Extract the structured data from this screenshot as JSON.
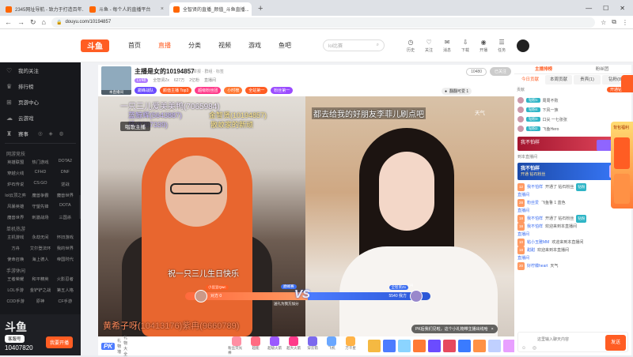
{
  "browser": {
    "tabs": [
      {
        "title": "2345网址导航 - 致力于打造百年..."
      },
      {
        "title": "斗鱼 - 每个人的直播平台"
      },
      {
        "title": "全智贤的直播_颜值_斗鱼直播..."
      }
    ],
    "url": "douyu.com/10194857"
  },
  "site": {
    "logo": "斗鱼",
    "nav": [
      "首页",
      "直播",
      "分类",
      "视频",
      "游戏",
      "鱼吧"
    ],
    "search_placeholder": "lol比赛",
    "header_icons": [
      {
        "label": "历史",
        "icon": "history-icon"
      },
      {
        "label": "关注",
        "icon": "heart-icon"
      },
      {
        "label": "消息",
        "icon": "message-icon"
      },
      {
        "label": "下载",
        "icon": "download-icon"
      },
      {
        "label": "开播",
        "icon": "camera-icon"
      },
      {
        "label": "任务",
        "icon": "task-icon"
      }
    ]
  },
  "sidebar": {
    "top_items": [
      {
        "label": "我的关注",
        "icon": "heart-icon"
      },
      {
        "label": "排行榜",
        "icon": "trophy-icon"
      },
      {
        "label": "页游中心",
        "icon": "gamepad-icon"
      },
      {
        "label": "云游戏",
        "icon": "cloud-icon"
      },
      {
        "label": "赛事",
        "icon": "cup-icon"
      }
    ],
    "sections": [
      {
        "title": "网游竞技",
        "items": [
          "英雄联盟",
          "热门游戏",
          "DOTA2",
          "穿越火线",
          "CFHD",
          "DNF",
          "炉石传说",
          "CS:GO",
          "逆战",
          "lol云顶之弈",
          "魔兽争霸",
          "魔兽世界",
          "风暴英雄",
          "守望先锋",
          "DOTA",
          "魔兽世界",
          "刺激战场",
          "三国杀"
        ]
      },
      {
        "title": "单机热游",
        "items": [
          "主机游戏",
          "永劫无间",
          "怀旧游戏",
          "方舟",
          "艾尔登法环",
          "我的世界",
          "使命召唤",
          "海上德人",
          "帝国时代"
        ]
      },
      {
        "title": "手游休闲",
        "items": [
          "王者荣耀",
          "和平精英",
          "火影忍者",
          "LOL手游",
          "金铲铲之战",
          "第五人格",
          "COD手游",
          "原神",
          "CF手游"
        ]
      }
    ],
    "bottom": {
      "logo": "斗鱼",
      "badge": "客服号",
      "number": "10407820",
      "button": "我要开播"
    }
  },
  "room": {
    "title": "主播是女的10194857",
    "links": "举报 · 群组 · 标签",
    "level": "LV48",
    "meta": [
      "全智贤Zx",
      "627万",
      "2亿粉",
      "直播间"
    ],
    "badges": [
      {
        "text": "巅峰战队",
        "color": "#6b4cff"
      },
      {
        "text": "颜值主播 Top3",
        "color": "#ff5d23"
      },
      {
        "text": "超级粉丝团",
        "color": "#ff3b8a"
      },
      {
        "text": "小时榜",
        "color": "#ff7a35"
      },
      {
        "text": "全站第一",
        "color": "#ff5d23"
      },
      {
        "text": "粉丝第一",
        "color": "#9b4cff"
      }
    ],
    "buttons": [
      "10480",
      "已关注"
    ],
    "user_tag": "翻翻可爱 1",
    "avatar_tag": "本直播间"
  },
  "video": {
    "danmaku_1": "一只三儿爱美美鸭(7065984)",
    "danmaku_2": "蓝鲸辉(5643887)",
    "danmaku_3": "金智贤(10194857)",
    "danmaku_4": "杨(8307339)",
    "danmaku_5": "散蚊家的新顽",
    "label_sing": "唱歌主播",
    "right_danmaku": "都去给我的好朋友李菲儿刷点吧",
    "right_label": "天气",
    "subtitle": "祝一只三儿生日快乐",
    "pk": {
      "vs": "VS",
      "left_name": "小豆豆Qwc",
      "left_score": "对方 0",
      "right_name": "全智贤Zx",
      "right_score": "5540 我方",
      "top": "巅峰赛",
      "bottom": "送礼为我方加分"
    },
    "pk_count": "1/4",
    "bottom_danmaku": "黄希子呀(10413176)紫冉(9660789)",
    "notice": "PK后我们见啦，这个小礼物带主播出线哈"
  },
  "gift_bar": {
    "pk_label": "PK",
    "pk_sub": "礼物墙",
    "left_label": "礼物大全",
    "gifts": [
      "粉丝荧光棒",
      "超能",
      "超级火箭",
      "超大火箭",
      "穿云箭",
      "飞机",
      "万千星"
    ],
    "colors": [
      "#ff8fa3",
      "#ff6b81",
      "#9b59ff",
      "#ff3b8a",
      "#7b68ee",
      "#6aa7ff",
      "#ffb347"
    ],
    "squares": [
      "#f5b942",
      "#4c7cff",
      "#8bd4ff",
      "#ff7a35",
      "#6b4cff",
      "#e64a5f",
      "#3a7bff",
      "#ff9145",
      "#c0d0ff",
      "#e8a0ff"
    ]
  },
  "right_panel": {
    "tabs": [
      "主播排榜",
      "粉丝团"
    ],
    "tabs2": [
      "今日贡献",
      "本周贡献",
      "贵宾(1)",
      "钻粉(8)"
    ],
    "subtabs": [
      "贡献",
      "",
      "",
      "开通钻粉"
    ],
    "ranks": [
      {
        "fan": "钻粉1",
        "text": "周周不败"
      },
      {
        "fan": "钻粉4",
        "text": "下风一族"
      },
      {
        "fan": "钻粉3",
        "text": "口尖 一七张张"
      },
      {
        "fan": "钻粉2",
        "text": "飞鱼Hero"
      }
    ],
    "card1": {
      "title": "我不怕样",
      "num": "66"
    },
    "follow_line": "到本直播间",
    "card2": {
      "title": "我不怕样",
      "sub": "开通 钻石粉丝"
    },
    "messages": [
      {
        "lv": "12",
        "name": "我不怕样",
        "text": "开通了 钻石粉丝",
        "fb": "钻粉"
      },
      {
        "lv": "",
        "name": "直播间",
        "text": "",
        "fb": ""
      },
      {
        "lv": "28",
        "name": "粉丝爱",
        "text": "飞鱼鲁 1 蓝色",
        "fb": ""
      },
      {
        "lv": "",
        "name": "直播间",
        "text": "",
        "fb": ""
      },
      {
        "lv": "18",
        "name": "我不怕样",
        "text": "开通了 钻石粉丝",
        "fb": "钻粉"
      },
      {
        "lv": "18",
        "name": "我不怕样",
        "text": "欢迎来到本直播间",
        "fb": ""
      },
      {
        "lv": "",
        "name": "直播间",
        "text": "",
        "fb": ""
      },
      {
        "lv": "10",
        "name": "粘小玉雅MM",
        "text": "欢迎来到本直播间",
        "fb": ""
      },
      {
        "lv": "18",
        "name": "甜甜",
        "text": "欢迎来到本直播间",
        "fb": ""
      },
      {
        "lv": "",
        "name": "直播间",
        "text": "",
        "fb": ""
      },
      {
        "lv": "20",
        "name": "好柠檬heart",
        "text": "天气",
        "fb": ""
      }
    ],
    "chat_placeholder": "这里输入聊天内容",
    "send": "发送"
  },
  "float_panel": {
    "title": "背包福利"
  }
}
